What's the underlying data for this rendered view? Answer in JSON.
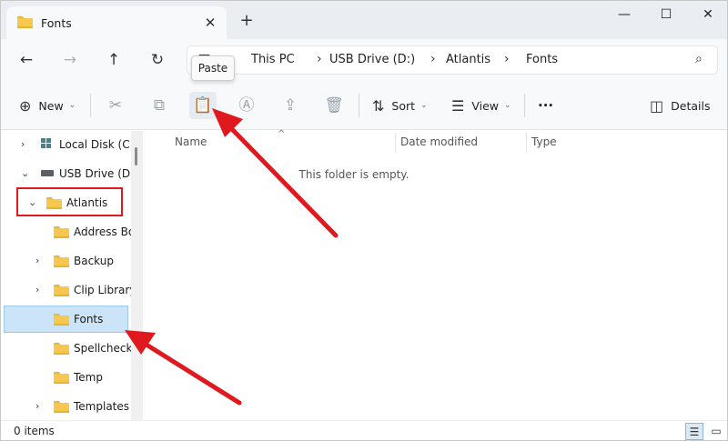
{
  "window": {
    "tab_title": "Fonts",
    "tab_close": "✕",
    "new_tab": "+",
    "minimize": "—",
    "maximize": "☐",
    "close": "✕"
  },
  "nav": {
    "back": "←",
    "forward": "→",
    "up": "↑",
    "refresh": "↻"
  },
  "address": {
    "crumbs": [
      "This PC",
      "USB Drive (D:)",
      "Atlantis",
      "Fonts"
    ],
    "separator": "›",
    "search_icon": "search-icon"
  },
  "toolbar": {
    "new_label": "New",
    "sort_label": "Sort",
    "view_label": "View",
    "more": "···",
    "details_label": "Details",
    "icons": [
      "cut-icon",
      "copy-icon",
      "paste-icon",
      "rename-icon",
      "share-icon",
      "delete-icon"
    ]
  },
  "tooltip": {
    "paste": "Paste"
  },
  "navpane": {
    "items": [
      {
        "label": "Local Disk (C:)",
        "expander": "›"
      },
      {
        "label": "USB Drive (D:)",
        "expander": "⌄"
      },
      {
        "label": "Atlantis",
        "expander": "⌄"
      },
      {
        "label": "Address Bo"
      },
      {
        "label": "Backup",
        "expander": "›"
      },
      {
        "label": "Clip Library",
        "expander": "›"
      },
      {
        "label": "Fonts",
        "selected": true
      },
      {
        "label": "Spellcheck"
      },
      {
        "label": "Temp"
      },
      {
        "label": "Templates",
        "expander": "›"
      }
    ]
  },
  "content": {
    "columns": [
      "Name",
      "Date modified",
      "Type"
    ],
    "sort_indicator": "^",
    "empty_message": "This folder is empty."
  },
  "status": {
    "items_count": "0 items"
  },
  "colors": {
    "annotation_red": "#e0191f",
    "selection_bg": "#cce4f7",
    "folder_yellow": "#f6c94e"
  }
}
